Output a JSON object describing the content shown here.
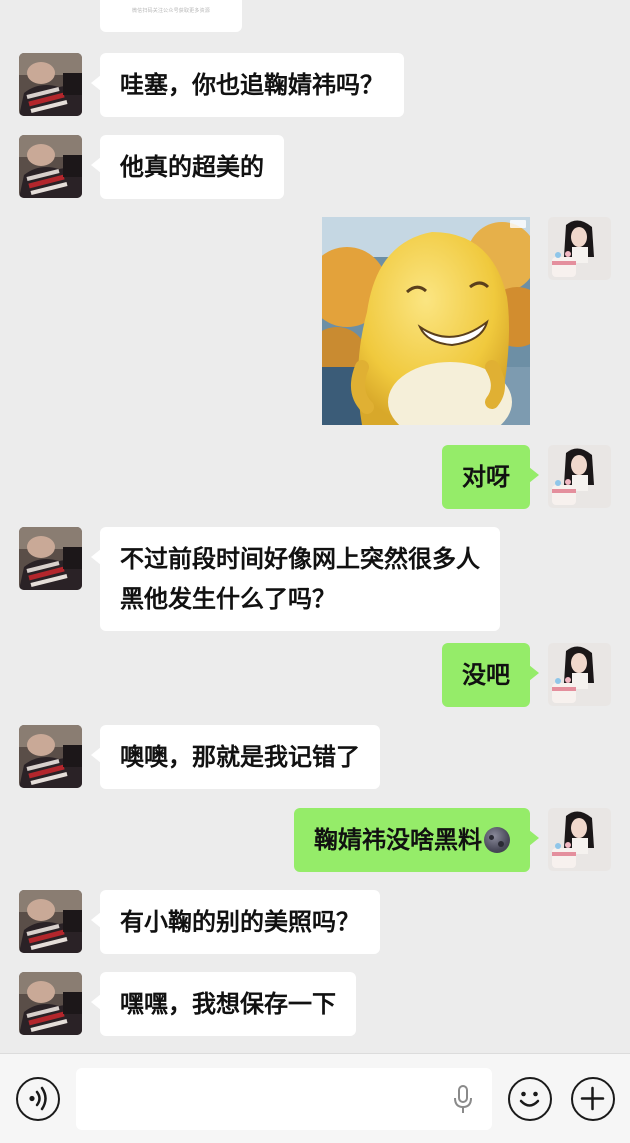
{
  "top_card": {
    "caption": "微信扫码关注公众号获取更多资源"
  },
  "messages": [
    {
      "side": "in",
      "text": "哇塞，你也追鞠婧祎吗？"
    },
    {
      "side": "in",
      "text": "他真的超美的"
    },
    {
      "side": "out",
      "type": "sticker",
      "description_icon": "yellow-blob-character-sticker"
    },
    {
      "side": "out",
      "text": "对呀"
    },
    {
      "side": "in",
      "lines": [
        "不过前段时间好像网上突然很多人",
        "黑他发生什么了吗？"
      ]
    },
    {
      "side": "out",
      "text": "没吧"
    },
    {
      "side": "in",
      "text": "噢噢，那就是我记错了"
    },
    {
      "side": "out",
      "text": "鞠婧祎没啥黑料",
      "emoji": "dark-moon-face-emoji"
    },
    {
      "side": "in",
      "text": "有小鞠的别的美照吗？"
    },
    {
      "side": "in",
      "text": "嘿嘿，我想保存一下"
    }
  ],
  "input_bar": {
    "voice_icon": "voice-icon",
    "mic_icon": "microphone-icon",
    "emoji_icon": "smiley-icon",
    "plus_icon": "plus-icon",
    "value": ""
  },
  "colors": {
    "background": "#ececec",
    "incoming_bubble": "#ffffff",
    "outgoing_bubble": "#95ec69",
    "input_bar": "#f6f6f6"
  }
}
